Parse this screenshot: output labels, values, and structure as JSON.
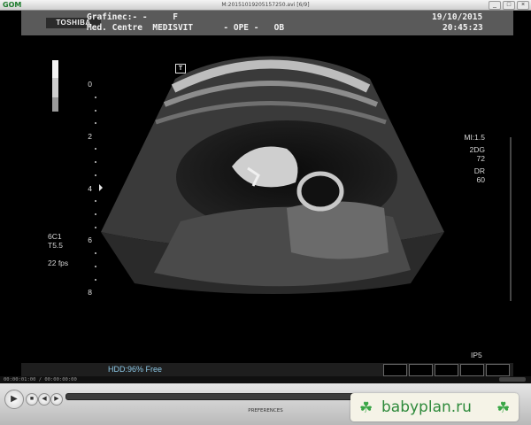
{
  "player": {
    "logo": "GOM",
    "file_title": "M:20151019205157250.avi [6/9]",
    "window_buttons": [
      "_",
      "□",
      "×"
    ],
    "time_display": "00:00:01:00 / 00:00:00:00",
    "seek_progress": 0.0,
    "preferences_label": "PREFERENCES"
  },
  "ultrasound": {
    "brand": "TOSHIBA",
    "patient_line": "Grafinec:- -     F",
    "centre_line": "Med. Centre  MEDISVIT      - OPE -   OB",
    "date": "19/10/2015",
    "time": "20:45:23",
    "depth_labels": [
      "0",
      "2",
      "4",
      "6",
      "8"
    ],
    "probe_info": [
      "6C1",
      "T5.5",
      "",
      "22 fps"
    ],
    "params": [
      "MI:1.5",
      "",
      "2DG",
      "72",
      "",
      "DR",
      "60"
    ],
    "ip": "IP5",
    "transducer_marker": "T",
    "hdd_status": "HDD:96% Free"
  },
  "watermark": {
    "text": "babyplan.ru",
    "icon": "clover-icon"
  },
  "colors": {
    "header_bg": "#5a5a5a",
    "hdd_text": "#8cc8e6",
    "watermark_green": "#2e8a3b"
  }
}
